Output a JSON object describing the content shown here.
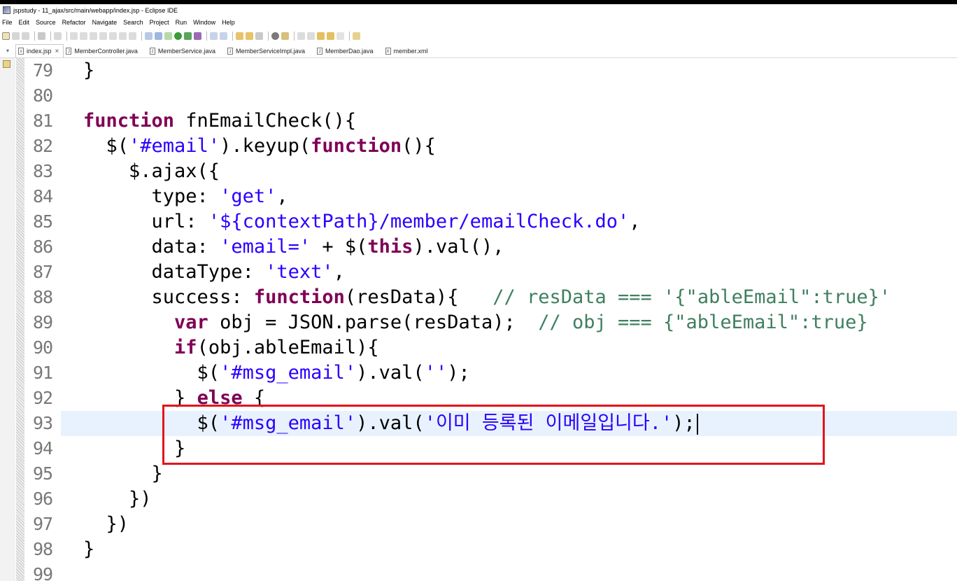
{
  "window": {
    "title": "jspstudy - 11_ajax/src/main/webapp/index.jsp - Eclipse IDE"
  },
  "menu": [
    "File",
    "Edit",
    "Source",
    "Refactor",
    "Navigate",
    "Search",
    "Project",
    "Run",
    "Window",
    "Help"
  ],
  "tabs": [
    {
      "label": "index.jsp",
      "icon": "jsp-file-icon",
      "active": true
    },
    {
      "label": "MemberController.java",
      "icon": "java-file-icon"
    },
    {
      "label": "MemberService.java",
      "icon": "java-file-icon"
    },
    {
      "label": "MemberServiceImpl.java",
      "icon": "java-file-icon"
    },
    {
      "label": "MemberDao.java",
      "icon": "java-file-icon"
    },
    {
      "label": "member.xml",
      "icon": "xml-file-icon"
    }
  ],
  "editor": {
    "current_line": "93",
    "lines": [
      {
        "num": "79",
        "segs": [
          {
            "t": "}",
            "c": "plain"
          }
        ]
      },
      {
        "num": "80",
        "segs": []
      },
      {
        "num": "81",
        "segs": [
          {
            "t": "function",
            "c": "kw"
          },
          {
            "t": " fnEmailCheck(){",
            "c": "plain"
          }
        ]
      },
      {
        "num": "82",
        "segs": [
          {
            "t": "  $(",
            "c": "plain"
          },
          {
            "t": "'#email'",
            "c": "str"
          },
          {
            "t": ").keyup(",
            "c": "plain"
          },
          {
            "t": "function",
            "c": "kw"
          },
          {
            "t": "(){",
            "c": "plain"
          }
        ]
      },
      {
        "num": "83",
        "segs": [
          {
            "t": "    $.ajax({",
            "c": "plain"
          }
        ]
      },
      {
        "num": "84",
        "segs": [
          {
            "t": "      type: ",
            "c": "plain"
          },
          {
            "t": "'get'",
            "c": "str"
          },
          {
            "t": ",",
            "c": "plain"
          }
        ]
      },
      {
        "num": "85",
        "segs": [
          {
            "t": "      url: ",
            "c": "plain"
          },
          {
            "t": "'${contextPath}/member/emailCheck.do'",
            "c": "str"
          },
          {
            "t": ",",
            "c": "plain"
          }
        ]
      },
      {
        "num": "86",
        "segs": [
          {
            "t": "      data: ",
            "c": "plain"
          },
          {
            "t": "'email='",
            "c": "str"
          },
          {
            "t": " + $(",
            "c": "plain"
          },
          {
            "t": "this",
            "c": "kw"
          },
          {
            "t": ").val(),",
            "c": "plain"
          }
        ]
      },
      {
        "num": "87",
        "segs": [
          {
            "t": "      dataType: ",
            "c": "plain"
          },
          {
            "t": "'text'",
            "c": "str"
          },
          {
            "t": ",",
            "c": "plain"
          }
        ]
      },
      {
        "num": "88",
        "segs": [
          {
            "t": "      success: ",
            "c": "plain"
          },
          {
            "t": "function",
            "c": "kw"
          },
          {
            "t": "(resData){   ",
            "c": "plain"
          },
          {
            "t": "// resData === '{\"ableEmail\":true}'",
            "c": "cm"
          }
        ]
      },
      {
        "num": "89",
        "segs": [
          {
            "t": "        ",
            "c": "plain"
          },
          {
            "t": "var",
            "c": "kw"
          },
          {
            "t": " obj = JSON.parse(resData);  ",
            "c": "plain"
          },
          {
            "t": "// obj === {\"ableEmail\":true}",
            "c": "cm"
          }
        ]
      },
      {
        "num": "90",
        "segs": [
          {
            "t": "        ",
            "c": "plain"
          },
          {
            "t": "if",
            "c": "kw"
          },
          {
            "t": "(obj.ableEmail){",
            "c": "plain"
          }
        ]
      },
      {
        "num": "91",
        "segs": [
          {
            "t": "          $(",
            "c": "plain"
          },
          {
            "t": "'#msg_email'",
            "c": "str"
          },
          {
            "t": ").val(",
            "c": "plain"
          },
          {
            "t": "''",
            "c": "str"
          },
          {
            "t": ");",
            "c": "plain"
          }
        ]
      },
      {
        "num": "92",
        "segs": [
          {
            "t": "        } ",
            "c": "plain"
          },
          {
            "t": "else",
            "c": "kw"
          },
          {
            "t": " {",
            "c": "plain"
          }
        ]
      },
      {
        "num": "93",
        "segs": [
          {
            "t": "          $(",
            "c": "plain"
          },
          {
            "t": "'#msg_email'",
            "c": "str"
          },
          {
            "t": ").val(",
            "c": "plain"
          },
          {
            "t": "'이미 등록된 이메일입니다.'",
            "c": "str"
          },
          {
            "t": ");",
            "c": "plain"
          }
        ]
      },
      {
        "num": "94",
        "segs": [
          {
            "t": "        }",
            "c": "plain"
          }
        ]
      },
      {
        "num": "95",
        "segs": [
          {
            "t": "      }",
            "c": "plain"
          }
        ]
      },
      {
        "num": "96",
        "segs": [
          {
            "t": "    })",
            "c": "plain"
          }
        ]
      },
      {
        "num": "97",
        "segs": [
          {
            "t": "  })",
            "c": "plain"
          }
        ]
      },
      {
        "num": "98",
        "segs": [
          {
            "t": "}",
            "c": "plain"
          }
        ]
      },
      {
        "num": "99",
        "segs": []
      }
    ]
  },
  "colors": {
    "keyword": "#7f0055",
    "string": "#2a00ff",
    "comment": "#3f7f5f",
    "current_line": "#e8f2fe",
    "annotation_box": "#e3141c"
  }
}
